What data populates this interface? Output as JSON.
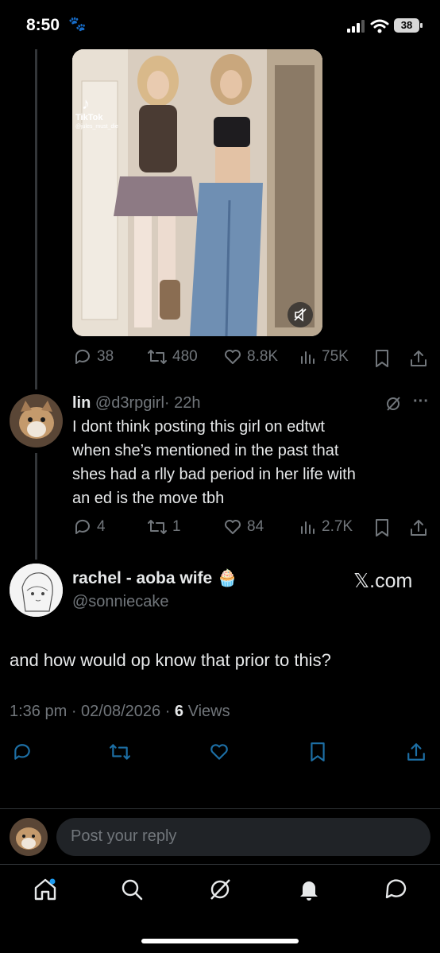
{
  "status_bar": {
    "time": "8:50",
    "battery": "38"
  },
  "parent_tweet": {
    "video": {
      "source_label": "TikTok",
      "source_handle": "@jules_must_die"
    },
    "actions": {
      "replies": "38",
      "reposts": "480",
      "likes": "8.8K",
      "views": "75K"
    }
  },
  "reply_tweet": {
    "display_name": "lin",
    "handle": "@d3rpgirl",
    "time_ago": "· 22h",
    "lines": [
      "I dont think posting this girl on edtwt",
      "when she’s mentioned in the past that",
      "shes had a rlly bad period in her life with",
      "an ed is the move tbh"
    ],
    "actions": {
      "replies": "4",
      "reposts": "1",
      "likes": "84",
      "views": "2.7K"
    }
  },
  "main_tweet": {
    "display_name": "rachel - aoba wife",
    "emoji": "🧁",
    "handle": "@sonniecake",
    "source_badge": "𝕏.com",
    "text": "and how would op know that prior to this?",
    "time": "1:36 pm · 02/08/2026 ·",
    "views_count": "6",
    "views_label": "Views"
  },
  "reply_bar": {
    "placeholder": "Post your reply"
  },
  "icons": {
    "reply": "reply-icon",
    "repost": "repost-icon",
    "like": "heart-icon",
    "views": "views-icon",
    "bookmark": "bookmark-icon",
    "share": "share-icon",
    "grok": "grok-icon",
    "more": "more-icon",
    "home": "home-icon",
    "search": "search-icon",
    "notifications": "bell-icon",
    "messages": "messages-icon"
  },
  "colors": {
    "background": "#000000",
    "text": "#e7e9ea",
    "muted": "#71767b",
    "accent": "#1d9bf0"
  }
}
